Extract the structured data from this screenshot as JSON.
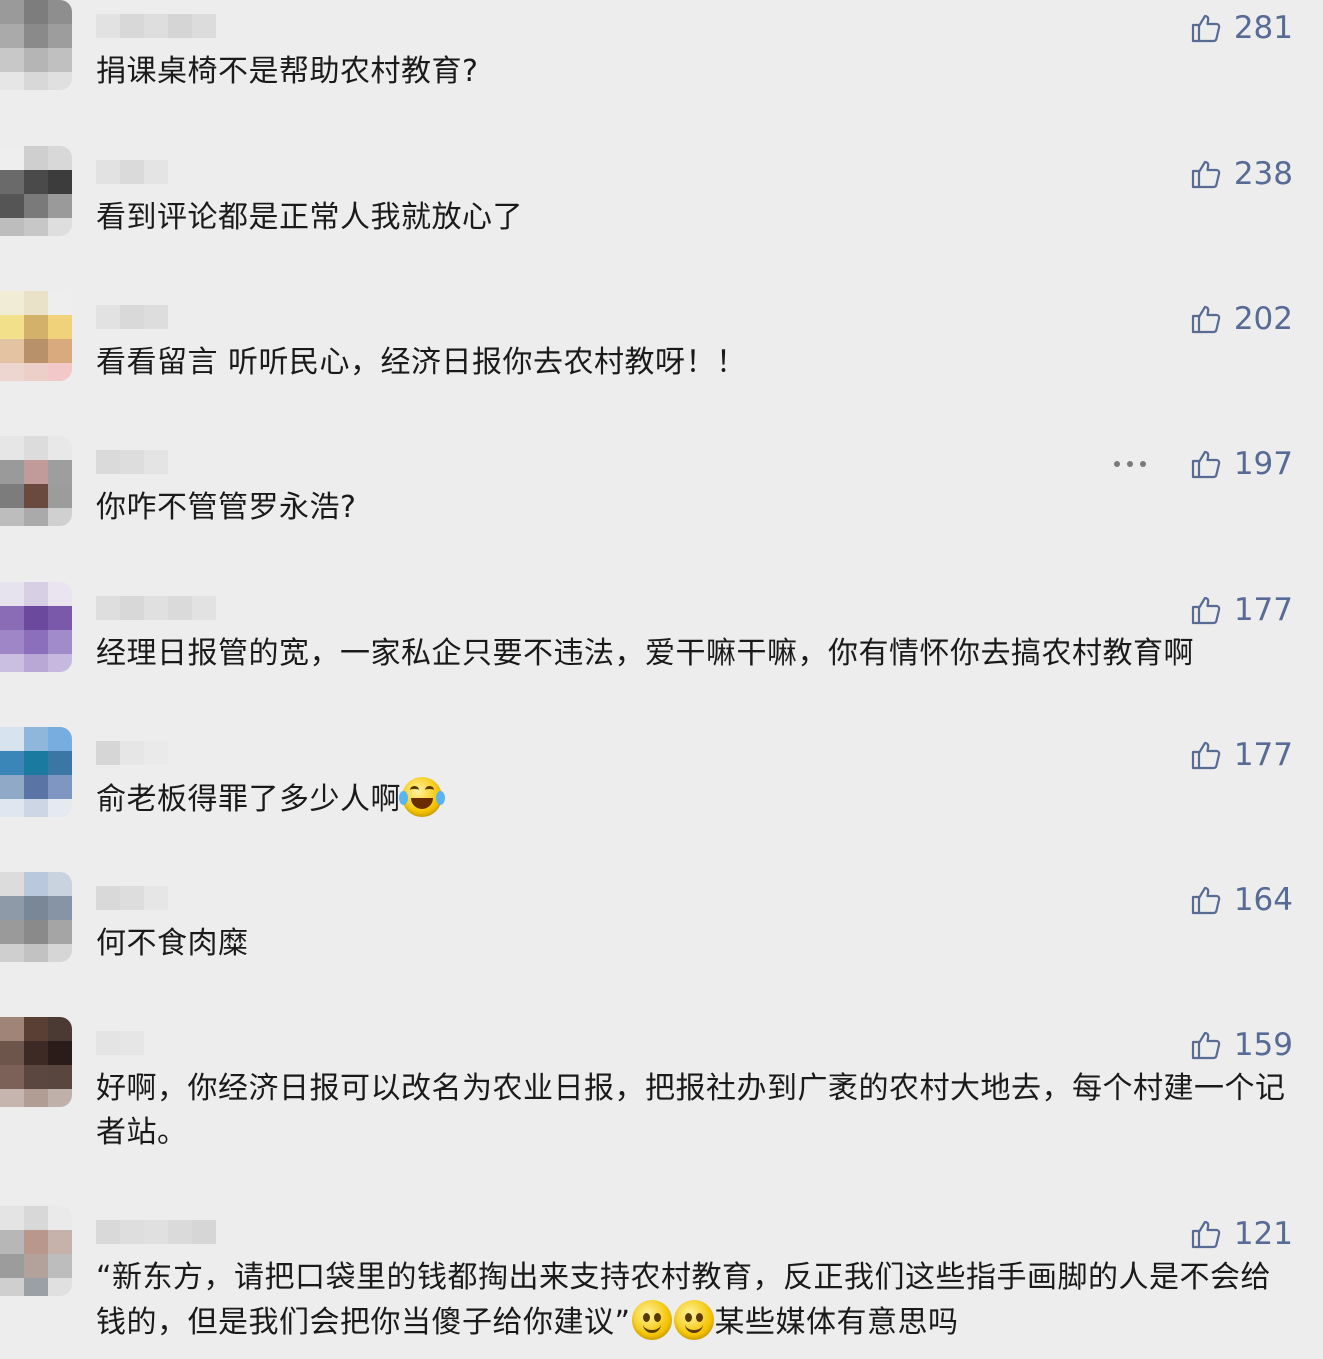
{
  "comments": [
    {
      "text": "捐课桌椅不是帮助农村教育?",
      "likes": "281",
      "emoji": [],
      "show_more": false,
      "avatar": [
        "#9a9a9a",
        "#7d7d7d",
        "#8e8e8e",
        "#aaaaaa",
        "#8a8a8a",
        "#9d9d9d",
        "#c8c8c8",
        "#b5b5b5",
        "#c0c0c0",
        "#e6e6e6",
        "#d8d8d8",
        "#e0e0e0"
      ],
      "name": [
        "#e2e2e2",
        "#d8d8d8",
        "#dedede",
        "#d5d5d5",
        "#dcdcdc"
      ]
    },
    {
      "text": "看到评论都是正常人我就放心了",
      "likes": "238",
      "emoji": [],
      "show_more": false,
      "avatar": [
        "#eeeeee",
        "#cfcfcf",
        "#d8d8d8",
        "#6a6a6a",
        "#4a4a4a",
        "#3c3c3c",
        "#555555",
        "#7a7a7a",
        "#9a9a9a",
        "#bdbdbd",
        "#c7c7c7",
        "#dedede"
      ],
      "name": [
        "#e2e2e2",
        "#dadada",
        "#e4e4e4"
      ]
    },
    {
      "text": "看看留言 听听民心，经济日报你去农村教呀！！",
      "likes": "202",
      "emoji": [],
      "show_more": false,
      "avatar": [
        "#f1ecd6",
        "#e9e2c8",
        "#eeeeee",
        "#f2e08a",
        "#d3b16a",
        "#f0d27a",
        "#e4c3a3",
        "#b8916b",
        "#d9aa7d",
        "#ecd6cf",
        "#eccfc9",
        "#f3c8c8"
      ],
      "name": [
        "#e2e2e2",
        "#d9d9d9",
        "#dddddd"
      ]
    },
    {
      "text": "你咋不管管罗永浩?",
      "likes": "197",
      "emoji": [],
      "show_more": true,
      "avatar": [
        "#e6e6e6",
        "#dcdcdc",
        "#e8e8e8",
        "#9a9a9a",
        "#c19a9a",
        "#9e9e9e",
        "#7c7c7c",
        "#6a4a3e",
        "#9c9c9c",
        "#bdbdbd",
        "#aaaaaa",
        "#d0d0d0"
      ],
      "name": [
        "#dadada",
        "#dddddd",
        "#e4e4e4"
      ]
    },
    {
      "text": "经理日报管的宽，一家私企只要不违法，爱干嘛干嘛，你有情怀你去搞农村教育啊",
      "likes": "177",
      "emoji": [],
      "show_more": false,
      "avatar": [
        "#e7e3ee",
        "#d7cfe4",
        "#e9e4ef",
        "#8a6bb5",
        "#6b4a9e",
        "#7a58aa",
        "#9f86c7",
        "#8b6fbc",
        "#a18bc9",
        "#cabfe0",
        "#b9a8d6",
        "#c6b8de"
      ],
      "name": [
        "#dedede",
        "#d8d8d8",
        "#e0e0e0",
        "#dadada",
        "#e2e2e2"
      ]
    },
    {
      "text": "俞老板得罪了多少人啊",
      "likes": "177",
      "emoji": [
        "laugh"
      ],
      "show_more": false,
      "avatar": [
        "#d7e3ee",
        "#8fb6db",
        "#76aee0",
        "#3a86b8",
        "#1b7aa0",
        "#3b77a5",
        "#8fa9c7",
        "#5b74a6",
        "#7f97c0",
        "#dfe6ef",
        "#cdd6e4",
        "#e5e9f0"
      ],
      "name": [
        "#d6d6d6",
        "#e6e6e6",
        "#eaeaea"
      ]
    },
    {
      "text": "何不食肉糜",
      "likes": "164",
      "emoji": [],
      "show_more": false,
      "avatar": [
        "#dcdcdc",
        "#b9c8dc",
        "#c9d3e0",
        "#8e9aa8",
        "#7a8797",
        "#8794a5",
        "#9a9a9a",
        "#8a8a8a",
        "#a5a5a5",
        "#cfcfcf",
        "#c2c2c2",
        "#d6d6d6"
      ],
      "name": [
        "#d9d9d9",
        "#dddddd",
        "#e6e6e6"
      ]
    },
    {
      "text": "好啊，你经济日报可以改名为农业日报，把报社办到广袤的农村大地去，每个村建一个记者站。",
      "likes": "159",
      "emoji": [],
      "show_more": false,
      "avatar": [
        "#a08478",
        "#5a3f35",
        "#4b3a33",
        "#6e554c",
        "#3d2a24",
        "#2a1d19",
        "#7b6157",
        "#5b4740",
        "#59463f",
        "#c6b5ae",
        "#b29d95",
        "#bfb0aa"
      ],
      "name": [
        "#e4e4e4",
        "#e6e6e6"
      ]
    },
    {
      "text": "“新东方，请把口袋里的钱都掏出来支持农村教育，反正我们这些指手画脚的人是不会给钱的，但是我们会把你当傻子给你建议”",
      "likes": "121",
      "emoji": [
        "smile",
        "smile"
      ],
      "tail": "某些媒体有意思吗",
      "show_more": false,
      "avatar": [
        "#e4e4e4",
        "#d8d8d8",
        "#eaeaea",
        "#b7b7b7",
        "#b9978c",
        "#c5b2ab",
        "#9c9c9c",
        "#b3a19b",
        "#bdbdbd",
        "#cfcfcf",
        "#9aa0a6",
        "#e0e0e0"
      ],
      "name": [
        "#d9d9d9",
        "#dedede",
        "#e0e0e0",
        "#dadada",
        "#d6d6d6"
      ]
    }
  ]
}
